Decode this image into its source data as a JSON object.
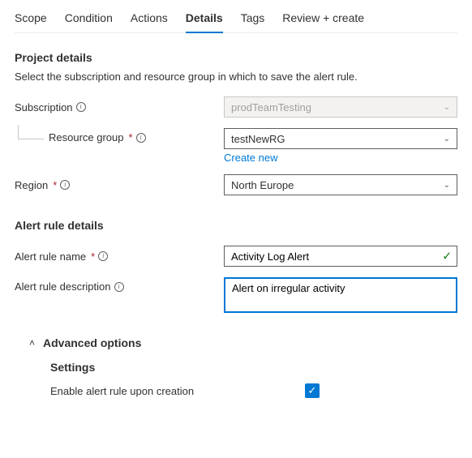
{
  "tabs": {
    "scope": "Scope",
    "condition": "Condition",
    "actions": "Actions",
    "details": "Details",
    "tags": "Tags",
    "review": "Review + create"
  },
  "project": {
    "title": "Project details",
    "desc": "Select the subscription and resource group in which to save the alert rule.",
    "subscription_label": "Subscription",
    "subscription_value": "prodTeamTesting",
    "rg_label": "Resource group",
    "rg_value": "testNewRG",
    "create_new": "Create new",
    "region_label": "Region",
    "region_value": "North Europe"
  },
  "alert": {
    "title": "Alert rule details",
    "name_label": "Alert rule name",
    "name_value": "Activity Log Alert",
    "desc_label": "Alert rule description",
    "desc_value": "Alert on irregular activity"
  },
  "advanced": {
    "header": "Advanced options",
    "settings": "Settings",
    "enable_label": "Enable alert rule upon creation"
  }
}
